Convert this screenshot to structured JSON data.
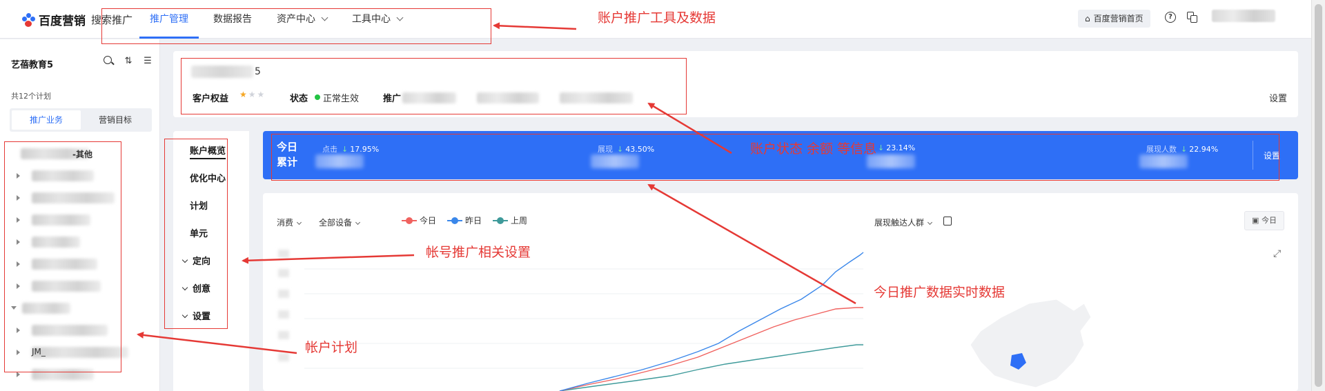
{
  "header": {
    "brand": "百度营销",
    "product": "搜索推广",
    "nav": [
      {
        "label": "推广管理",
        "active": true,
        "has_dropdown": false
      },
      {
        "label": "数据报告",
        "active": false,
        "has_dropdown": false
      },
      {
        "label": "资产中心",
        "active": false,
        "has_dropdown": true
      },
      {
        "label": "工具中心",
        "active": false,
        "has_dropdown": true
      }
    ],
    "home_button": "百度营销首页",
    "help_icon": "help-icon",
    "copy_icon": "copy-icon"
  },
  "sidebar": {
    "account_name": "艺蓓教育5",
    "plan_count": "共12个计划",
    "tabs": [
      {
        "label": "推广业务",
        "active": true
      },
      {
        "label": "营销目标",
        "active": false
      }
    ],
    "tree": [
      {
        "text": "-其他",
        "expanded": false,
        "bold": true
      },
      {
        "text": "",
        "expanded": false
      },
      {
        "text": "",
        "expanded": false
      },
      {
        "text": "",
        "expanded": false
      },
      {
        "text": "",
        "expanded": false
      },
      {
        "text": "",
        "expanded": false
      },
      {
        "text": "",
        "expanded": false
      },
      {
        "text": "",
        "expanded": true
      },
      {
        "text": "",
        "expanded": false
      },
      {
        "text": "JM_",
        "expanded": false
      },
      {
        "text": "",
        "expanded": false
      }
    ]
  },
  "subnav": {
    "items": [
      {
        "label": "账户概览",
        "active": true,
        "collapsible": false
      },
      {
        "label": "优化中心",
        "active": false,
        "collapsible": false
      },
      {
        "label": "计划",
        "active": false,
        "collapsible": false
      },
      {
        "label": "单元",
        "active": false,
        "collapsible": false
      },
      {
        "label": "定向",
        "active": false,
        "collapsible": true
      },
      {
        "label": "创意",
        "active": false,
        "collapsible": true
      },
      {
        "label": "设置",
        "active": false,
        "collapsible": true
      }
    ]
  },
  "account": {
    "id_suffix": "5",
    "rights_label": "客户权益",
    "rights_stars": 1,
    "rights_max": 3,
    "status_label": "状态",
    "status_value": "正常生效",
    "promo_label": "推广",
    "settings": "设置"
  },
  "stats": {
    "title_line1": "今日",
    "title_line2": "累计",
    "items": [
      {
        "label": "点击",
        "change": "17.95%",
        "direction": "down"
      },
      {
        "label": "展现",
        "change": "43.50%",
        "direction": "down"
      },
      {
        "label": "",
        "change": "23.14%",
        "direction": "down"
      },
      {
        "label": "展现人数",
        "change": "22.94%",
        "direction": "down"
      }
    ],
    "settings": "设置"
  },
  "chart_panel": {
    "metric_select": "消费",
    "device_select": "全部设备",
    "legend": [
      {
        "name": "今日",
        "color": "#f0625f"
      },
      {
        "name": "昨日",
        "color": "#3a87ea"
      },
      {
        "name": "上周",
        "color": "#3e9a9a"
      }
    ],
    "reach_select": "展现触达人群",
    "today_button": "今日"
  },
  "annotations": {
    "tools": "账户推广工具及数据",
    "status": "账户状态 余额 等信息",
    "settings": "帐号推广相关设置",
    "realtime": "今日推广数据实时数据",
    "plans": "帐户计划"
  }
}
